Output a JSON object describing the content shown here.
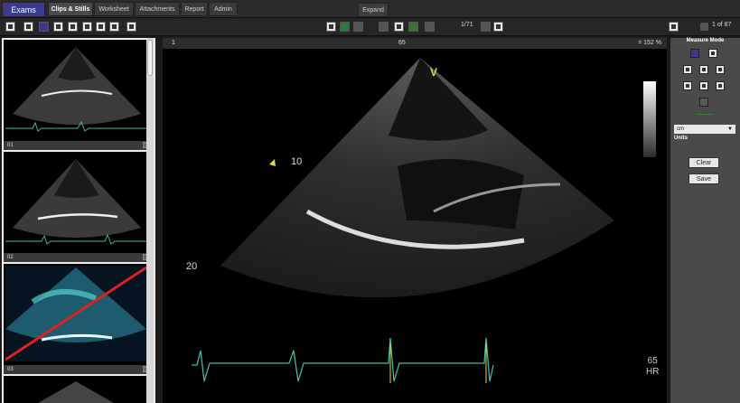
{
  "nav": {
    "exams": "Exams",
    "clips": "Clips & Stills",
    "worksheet": "Worksheet",
    "attachments": "Attachments",
    "report": "Report",
    "admin": "Admin",
    "expand": "Expand"
  },
  "toolbar": {
    "frame_counter": "1/71",
    "page_counter": "1 of 87"
  },
  "thumbs": [
    {
      "label": "01"
    },
    {
      "label": "02"
    },
    {
      "label": "03"
    }
  ],
  "viewer": {
    "index": "1",
    "heart_rate": "65",
    "zoom": "= 152 %",
    "depth_10": "10",
    "depth_20": "20",
    "marker_v": "V",
    "hr_value": "65",
    "hr_label": "HR"
  },
  "side": {
    "title": "Measure Mode",
    "unit_value": "cm",
    "units_label": "Units",
    "clear": "Clear",
    "save": "Save"
  },
  "colors": {
    "accent": "#3b3a8e",
    "ecg": "#3fb8a5",
    "active": "#2f7a2f"
  }
}
